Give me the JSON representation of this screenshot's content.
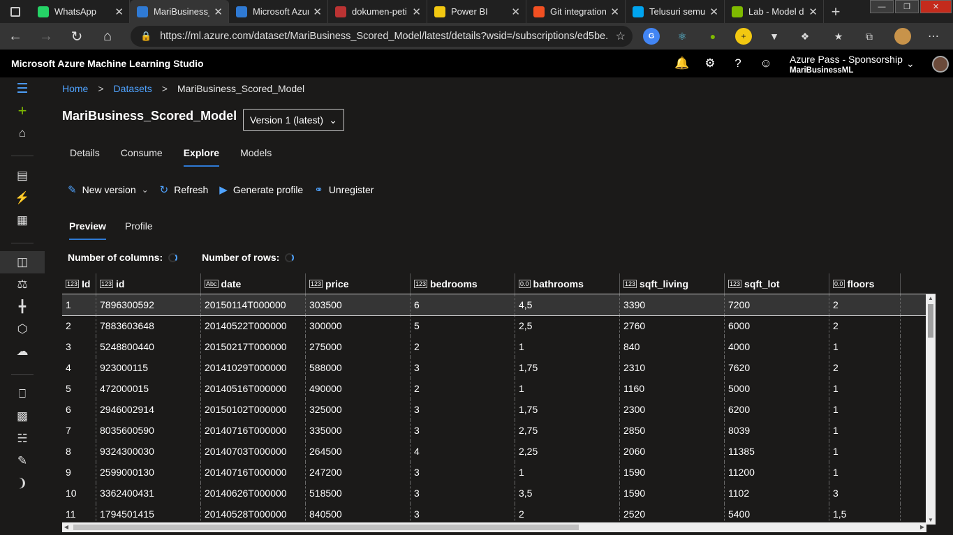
{
  "browser": {
    "tabs": [
      {
        "title": "WhatsApp",
        "color": "#25d366"
      },
      {
        "title": "MariBusiness_S",
        "color": "#2f7ad4"
      },
      {
        "title": "Microsoft Azur",
        "color": "#2f7ad4"
      },
      {
        "title": "dokumen-peti",
        "color": "#b33"
      },
      {
        "title": "Power BI",
        "color": "#f2c811"
      },
      {
        "title": "Git integration",
        "color": "#f25022"
      },
      {
        "title": "Telusuri semua",
        "color": "#00a4ef"
      },
      {
        "title": "Lab - Model da",
        "color": "#7fba00"
      }
    ],
    "url": "https://ml.azure.com/dataset/MariBusiness_Scored_Model/latest/details?wsid=/subscriptions/ed5be..."
  },
  "header": {
    "app_title": "Microsoft Azure Machine Learning Studio",
    "account_name": "Azure Pass - Sponsorship",
    "workspace": "MariBusinessML"
  },
  "breadcrumb": {
    "home": "Home",
    "datasets": "Datasets",
    "current": "MariBusiness_Scored_Model",
    "sep": ">"
  },
  "page": {
    "title": "MariBusiness_Scored_Model",
    "version": "Version 1 (latest)"
  },
  "tabs": [
    "Details",
    "Consume",
    "Explore",
    "Models"
  ],
  "active_tab": "Explore",
  "toolbar": {
    "new_version": "New version",
    "refresh": "Refresh",
    "generate_profile": "Generate profile",
    "unregister": "Unregister"
  },
  "subtabs": [
    "Preview",
    "Profile"
  ],
  "counts": {
    "columns_label": "Number of columns:",
    "rows_label": "Number of rows:"
  },
  "table": {
    "columns": [
      {
        "type": "123",
        "name": "Id"
      },
      {
        "type": "123",
        "name": "id"
      },
      {
        "type": "Abc",
        "name": "date"
      },
      {
        "type": "123",
        "name": "price"
      },
      {
        "type": "123",
        "name": "bedrooms"
      },
      {
        "type": "0.0",
        "name": "bathrooms"
      },
      {
        "type": "123",
        "name": "sqft_living"
      },
      {
        "type": "123",
        "name": "sqft_lot"
      },
      {
        "type": "0.0",
        "name": "floors"
      }
    ],
    "rows": [
      [
        "1",
        "7896300592",
        "20150114T000000",
        "303500",
        "6",
        "4,5",
        "3390",
        "7200",
        "2"
      ],
      [
        "2",
        "7883603648",
        "20140522T000000",
        "300000",
        "5",
        "2,5",
        "2760",
        "6000",
        "2"
      ],
      [
        "3",
        "5248800440",
        "20150217T000000",
        "275000",
        "2",
        "1",
        "840",
        "4000",
        "1"
      ],
      [
        "4",
        "923000115",
        "20141029T000000",
        "588000",
        "3",
        "1,75",
        "2310",
        "7620",
        "2"
      ],
      [
        "5",
        "472000015",
        "20140516T000000",
        "490000",
        "2",
        "1",
        "1160",
        "5000",
        "1"
      ],
      [
        "6",
        "2946002914",
        "20150102T000000",
        "325000",
        "3",
        "1,75",
        "2300",
        "6200",
        "1"
      ],
      [
        "7",
        "8035600590",
        "20140716T000000",
        "335000",
        "3",
        "2,75",
        "2850",
        "8039",
        "1"
      ],
      [
        "8",
        "9324300030",
        "20140703T000000",
        "264500",
        "4",
        "2,25",
        "2060",
        "11385",
        "1"
      ],
      [
        "9",
        "2599000130",
        "20140716T000000",
        "247200",
        "3",
        "1",
        "1590",
        "11200",
        "1"
      ],
      [
        "10",
        "3362400431",
        "20140626T000000",
        "518500",
        "3",
        "3,5",
        "1590",
        "1102",
        "3"
      ],
      [
        "11",
        "1794501415",
        "20140528T000000",
        "840500",
        "3",
        "2",
        "2520",
        "5400",
        "1,5"
      ]
    ]
  }
}
